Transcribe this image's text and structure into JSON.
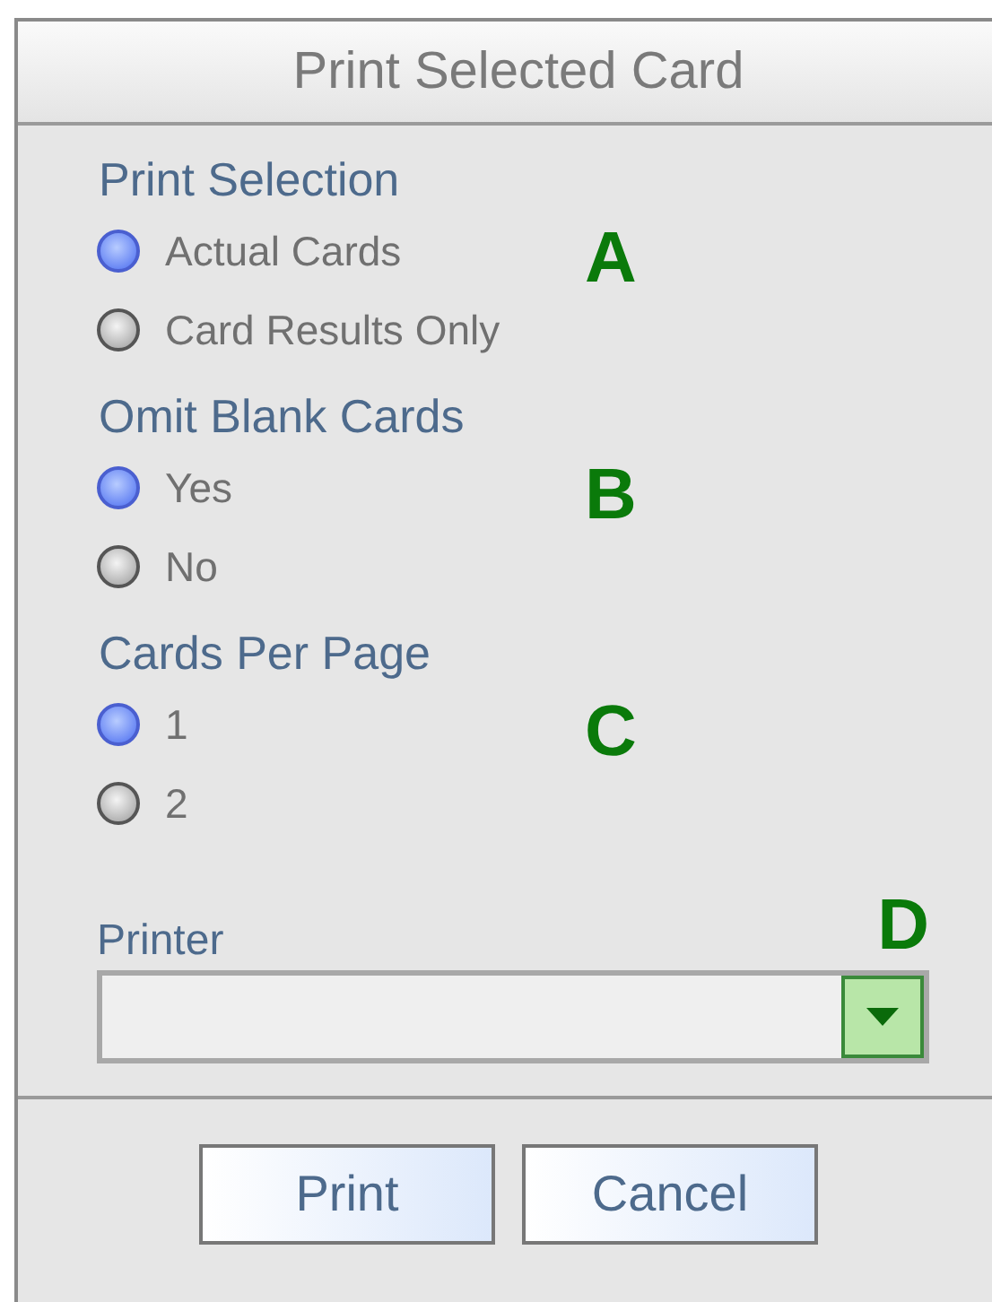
{
  "window": {
    "title": "Print Selected Card"
  },
  "groups": [
    {
      "heading": "Print Selection",
      "annotation": "A",
      "options": [
        {
          "label": "Actual Cards",
          "selected": true
        },
        {
          "label": "Card Results Only",
          "selected": false
        }
      ]
    },
    {
      "heading": "Omit Blank Cards",
      "annotation": "B",
      "options": [
        {
          "label": "Yes",
          "selected": true
        },
        {
          "label": "No",
          "selected": false
        }
      ]
    },
    {
      "heading": "Cards Per Page",
      "annotation": "C",
      "options": [
        {
          "label": "1",
          "selected": true
        },
        {
          "label": "2",
          "selected": false
        }
      ]
    }
  ],
  "printer": {
    "label": "Printer",
    "annotation": "D"
  },
  "buttons": [
    "Print",
    "Cancel"
  ]
}
